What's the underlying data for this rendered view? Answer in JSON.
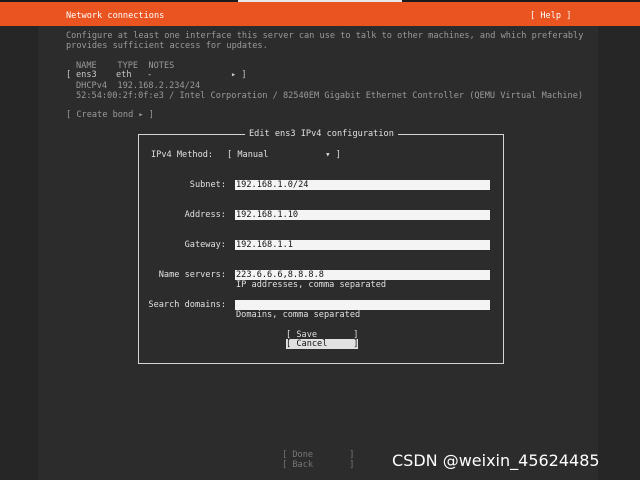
{
  "header": {
    "title": "Network connections",
    "help": "[ Help ]"
  },
  "intro": {
    "line1": "Configure at least one interface this server can use to talk to other machines, and which preferably",
    "line2": "provides sufficient access for updates."
  },
  "table": {
    "columns": "NAME    TYPE  NOTES",
    "row": {
      "open": "[",
      "name": "ens3",
      "type": "eth",
      "notes": "-",
      "arrow": "▸ ]"
    },
    "detail1": "DHCPv4  192.168.2.234/24",
    "detail2": "52:54:00:2f:0f:e3 / Intel Corporation / 82540EM Gigabit Ethernet Controller (QEMU Virtual Machine)"
  },
  "create_bond": "[ Create bond ▸ ]",
  "dialog": {
    "title": "Edit ens3 IPv4 configuration",
    "method_label": "IPv4 Method:",
    "method_value": "[ Manual           ▾ ]",
    "subnet_label": "Subnet:",
    "subnet_value": "192.168.1.0/24",
    "address_label": "Address:",
    "address_value": "192.168.1.10",
    "gateway_label": "Gateway:",
    "gateway_value": "192.168.1.1",
    "nameservers_label": "Name servers:",
    "nameservers_value": "223.6.6.6,8.8.8.8",
    "nameservers_hint": "IP addresses, comma separated",
    "searchdomains_label": "Search domains:",
    "searchdomains_value": "",
    "searchdomains_hint": "Domains, comma separated",
    "save": "[ Save       ]",
    "cancel": "[ Cancel     ]"
  },
  "footer": {
    "done": "[ Done       ]",
    "back": "[ Back       ]"
  },
  "watermark": "CSDN @weixin_45624485",
  "colors": {
    "accent": "#e95420",
    "background": "#2c2c2c",
    "field": "#f4f4f4"
  }
}
